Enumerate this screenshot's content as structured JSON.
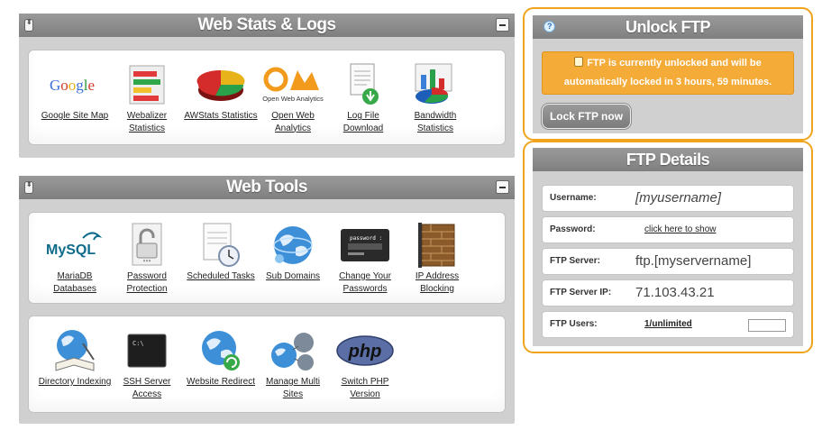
{
  "stats_panel": {
    "title": "Web Stats & Logs",
    "tiles": [
      {
        "icon": "google-icon",
        "logo": "Google",
        "label": "Google Site Map"
      },
      {
        "icon": "webalizer-icon",
        "label": "Webalizer Statistics"
      },
      {
        "icon": "awstats-icon",
        "label": "AWStats Statistics"
      },
      {
        "icon": "open-web-analytics-icon",
        "logo": "Open Web Analytics",
        "label": "Open Web Analytics"
      },
      {
        "icon": "log-file-icon",
        "label": "Log File Download"
      },
      {
        "icon": "bandwidth-icon",
        "label": "Bandwidth Statistics"
      }
    ]
  },
  "tools_panel": {
    "title": "Web Tools",
    "tiles_row1": [
      {
        "icon": "mysql-icon",
        "logo": "MySQL",
        "label": "MariaDB Databases"
      },
      {
        "icon": "padlock-icon",
        "label": "Password Protection"
      },
      {
        "icon": "clipboard-clock-icon",
        "label": "Scheduled Tasks"
      },
      {
        "icon": "globe-icon",
        "label": "Sub Domains"
      },
      {
        "icon": "password-screen-icon",
        "logo": "password :",
        "label": "Change Your Passwords"
      },
      {
        "icon": "brick-wall-icon",
        "label": "IP Address Blocking"
      }
    ],
    "tiles_row2": [
      {
        "icon": "globe-book-icon",
        "label": "Directory Indexing"
      },
      {
        "icon": "terminal-icon",
        "logo": "C:\\",
        "label": "SSH Server Access"
      },
      {
        "icon": "globe-redirect-icon",
        "label": "Website Redirect"
      },
      {
        "icon": "multi-globe-icon",
        "label": "Manage Multi Sites"
      },
      {
        "icon": "php-icon",
        "logo": "php",
        "label": "Switch PHP Version"
      }
    ]
  },
  "unlock_ftp": {
    "title": "Unlock FTP",
    "alert_line1": "FTP is currently unlocked and will be",
    "alert_line2": "automatically locked in 3 hours, 59 minutes.",
    "button": "Lock FTP now"
  },
  "ftp_details": {
    "title": "FTP Details",
    "rows": [
      {
        "key": "Username:",
        "value": "[myusername]"
      },
      {
        "key": "Password:",
        "value": "click here to show"
      },
      {
        "key": "FTP Server:",
        "value": "ftp.[myservername]"
      },
      {
        "key": "FTP Server IP:",
        "value": "71.103.43.21"
      },
      {
        "key": "FTP Users:",
        "value": "1/unlimited"
      }
    ]
  },
  "colors": {
    "accent_orange": "#f0a41e",
    "alert_bg": "#f5ab38",
    "header_gray": "#8c8c8c",
    "panel_gray": "#d0d0d0"
  }
}
